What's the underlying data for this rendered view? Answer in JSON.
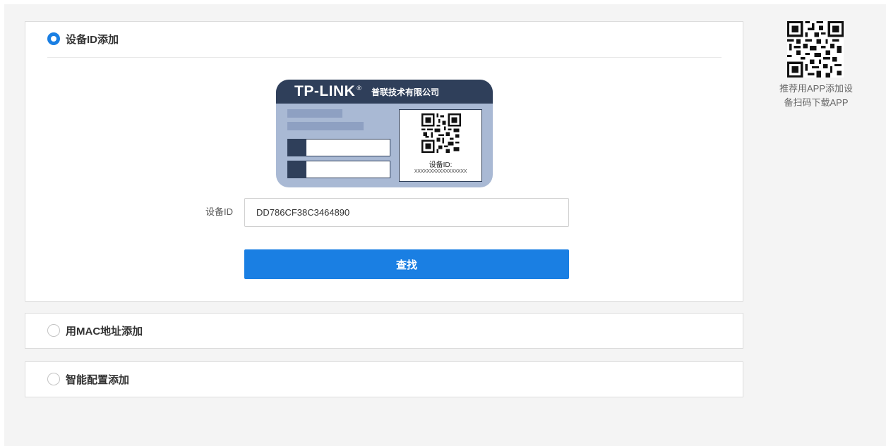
{
  "options": {
    "by_id": {
      "label": "设备ID添加",
      "selected": true
    },
    "by_mac": {
      "label": "用MAC地址添加",
      "selected": false
    },
    "smart": {
      "label": "智能配置添加",
      "selected": false
    }
  },
  "device_card": {
    "brand": "TP-LINK",
    "brand_mark": "®",
    "company": "普联技术有限公司",
    "id_label": "设备ID:",
    "id_value": "XXXXXXXXXXXXXXXXX"
  },
  "form": {
    "device_id_label": "设备ID",
    "device_id_value": "DD786CF38C3464890",
    "find_button": "查找"
  },
  "app_promo": {
    "line1": "推荐用APP添加设",
    "line2": "备扫码下载APP"
  },
  "colors": {
    "accent": "#1a7fe3",
    "card_dark": "#2f3f5a",
    "card_body": "#a9b9d4"
  },
  "icons": [
    "radio-checked-icon",
    "radio-unchecked-icon",
    "qr-code-icon"
  ]
}
